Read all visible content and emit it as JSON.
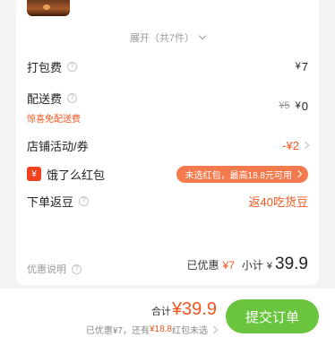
{
  "expand": {
    "label": "展开（共7件）"
  },
  "fees": {
    "packaging": {
      "label": "打包费",
      "value": "7"
    },
    "delivery": {
      "label": "配送费",
      "original": "¥5",
      "value": "0",
      "note": "惊喜免配送费"
    },
    "store_activity": {
      "label": "店铺活动/券",
      "value": "-¥2"
    },
    "hongbao": {
      "label": "饿了么红包",
      "icon_text": "¥",
      "pill": "未选红包，最高18.8元可用"
    },
    "beans": {
      "label": "下单返豆",
      "value": "返40吃货豆"
    }
  },
  "summary": {
    "discount_note": "优惠说明",
    "saved_label": "已优惠",
    "saved_value": "¥7",
    "subtotal_label": "小计",
    "subtotal_value": "39.9"
  },
  "bottom": {
    "total_label": "合计",
    "total_value": "¥39.9",
    "saved_text_1": "已优惠¥7，还有",
    "saved_text_red": "¥18.8",
    "saved_text_2": "红包未选",
    "submit_label": "提交订单"
  },
  "colors": {
    "accent": "#f2561f",
    "submit": "#6ac43e",
    "pill": "#f47a4e"
  }
}
